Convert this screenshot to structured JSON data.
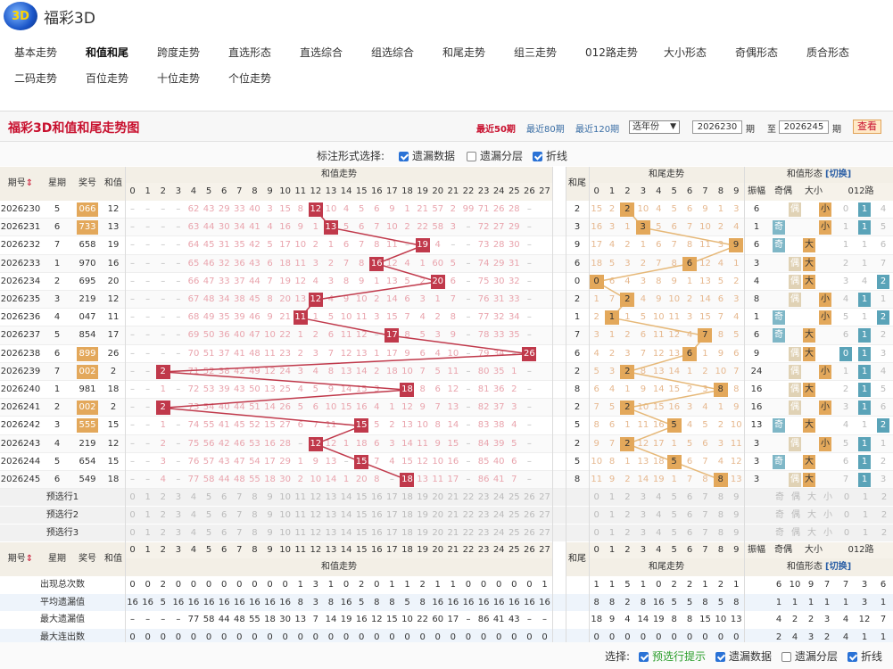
{
  "app": {
    "title": "福彩3D",
    "logo_text": "3D"
  },
  "nav": {
    "row1": [
      "基本走势",
      "和值和尾",
      "跨度走势",
      "直选形态",
      "直选综合",
      "组选综合",
      "和尾走势",
      "组三走势",
      "012路走势",
      "大小形态",
      "奇偶形态",
      "质合形态"
    ],
    "row2": [
      "二码走势",
      "百位走势",
      "十位走势",
      "个位走势"
    ],
    "active": "和值和尾"
  },
  "panel": {
    "title": "福彩3D和值和尾走势图",
    "ranges": [
      "最近50期",
      "最近80期",
      "最近120期"
    ],
    "year_select": "选年份",
    "from_label": "期",
    "to_label": "至",
    "to_label2": "期",
    "from_period": "2026230",
    "to_period": "2026245",
    "query": "查看"
  },
  "marking": {
    "label": "标注形式选择:",
    "options": [
      {
        "label": "遗漏数据",
        "checked": true
      },
      {
        "label": "遗漏分层",
        "checked": false
      },
      {
        "label": "折线",
        "checked": true
      }
    ]
  },
  "columns": {
    "issue": "期号",
    "week": "星期",
    "prize": "奖号",
    "sum": "和值",
    "sum_trend": "和值走势",
    "tail": "和尾",
    "tail_trend": "和尾走势",
    "form": "和值形态",
    "switch": "[切换]",
    "amplitude": "振幅",
    "parity": "奇偶",
    "size": "大小",
    "route": "012路",
    "sort_icon": "⇕"
  },
  "rows": [
    {
      "issue": "2026230",
      "week": "5",
      "prize": "066",
      "sum": 12,
      "tail": 2,
      "hl": true,
      "amp": "6",
      "par": "偶",
      "sz": "小",
      "route": [
        0,
        "",
        4
      ],
      "sum_omit": [
        "",
        "",
        "",
        "",
        "62",
        "43",
        "29",
        "33",
        "40",
        "3",
        "15",
        "8",
        "",
        "10",
        "4",
        "5",
        "6",
        "9",
        "1",
        "21",
        "57",
        "2",
        "99",
        "71",
        "26",
        "28",
        ""
      ],
      "tail_omit": [
        "15",
        "2",
        "",
        "10",
        "4",
        "5",
        "6",
        "9",
        "1",
        "3"
      ]
    },
    {
      "issue": "2026231",
      "week": "6",
      "prize": "733",
      "sum": 13,
      "tail": 3,
      "hl": true,
      "amp": "1",
      "par": "奇",
      "sz": "小",
      "route": [
        1,
        "",
        5
      ],
      "sum_omit": [
        "",
        "",
        "",
        "",
        "63",
        "44",
        "30",
        "34",
        "41",
        "4",
        "16",
        "9",
        "1",
        "",
        "5",
        "6",
        "7",
        "10",
        "2",
        "22",
        "58",
        "3",
        "",
        "72",
        "27",
        "29",
        ""
      ],
      "tail_omit": [
        "16",
        "3",
        "1",
        "",
        "5",
        "6",
        "7",
        "10",
        "2",
        "4"
      ]
    },
    {
      "issue": "2026232",
      "week": "7",
      "prize": "658",
      "sum": 19,
      "tail": 9,
      "hl": false,
      "amp": "6",
      "par": "奇",
      "sz": "大",
      "route": [
        1,
        1,
        6
      ],
      "sum_omit": [
        "",
        "",
        "",
        "",
        "64",
        "45",
        "31",
        "35",
        "42",
        "5",
        "17",
        "10",
        "2",
        "1",
        "6",
        "7",
        "8",
        "11",
        "",
        "59",
        "4",
        "",
        "",
        "73",
        "28",
        "30",
        ""
      ],
      "tail_omit": [
        "17",
        "4",
        "2",
        "1",
        "6",
        "7",
        "8",
        "11",
        "3",
        ""
      ]
    },
    {
      "issue": "2026233",
      "week": "1",
      "prize": "970",
      "sum": 16,
      "tail": 6,
      "hl": false,
      "amp": "3",
      "par": "偶",
      "sz": "大",
      "route": [
        2,
        1,
        7
      ],
      "sum_omit": [
        "",
        "",
        "",
        "",
        "65",
        "46",
        "32",
        "36",
        "43",
        "6",
        "18",
        "11",
        "3",
        "2",
        "7",
        "8",
        "",
        "12",
        "4",
        "1",
        "60",
        "5",
        "",
        "74",
        "29",
        "31",
        ""
      ],
      "tail_omit": [
        "18",
        "5",
        "3",
        "2",
        "7",
        "8",
        "",
        "12",
        "4",
        "1"
      ]
    },
    {
      "issue": "2026234",
      "week": "2",
      "prize": "695",
      "sum": 20,
      "tail": 0,
      "hl": false,
      "amp": "4",
      "par": "偶",
      "sz": "大",
      "route": [
        3,
        4,
        ""
      ],
      "sum_omit": [
        "",
        "",
        "",
        "",
        "66",
        "47",
        "33",
        "37",
        "44",
        "7",
        "19",
        "12",
        "4",
        "3",
        "8",
        "9",
        "1",
        "13",
        "5",
        "2",
        "",
        "6",
        "",
        "75",
        "30",
        "32",
        ""
      ],
      "tail_omit": [
        "",
        "6",
        "4",
        "3",
        "8",
        "9",
        "1",
        "13",
        "5",
        "2"
      ]
    },
    {
      "issue": "2026235",
      "week": "3",
      "prize": "219",
      "sum": 12,
      "tail": 2,
      "hl": false,
      "amp": "8",
      "par": "偶",
      "sz": "小",
      "route": [
        4,
        "",
        1
      ],
      "sum_omit": [
        "",
        "",
        "",
        "",
        "67",
        "48",
        "34",
        "38",
        "45",
        "8",
        "20",
        "13",
        "",
        "4",
        "9",
        "10",
        "2",
        "14",
        "6",
        "3",
        "1",
        "7",
        "",
        "76",
        "31",
        "33",
        ""
      ],
      "tail_omit": [
        "1",
        "7",
        "",
        "4",
        "9",
        "10",
        "2",
        "14",
        "6",
        "3"
      ]
    },
    {
      "issue": "2026236",
      "week": "4",
      "prize": "047",
      "sum": 11,
      "tail": 1,
      "hl": false,
      "amp": "1",
      "par": "奇",
      "sz": "小",
      "route": [
        5,
        1,
        ""
      ],
      "sum_omit": [
        "",
        "",
        "",
        "",
        "68",
        "49",
        "35",
        "39",
        "46",
        "9",
        "21",
        "",
        "1",
        "5",
        "10",
        "11",
        "3",
        "15",
        "7",
        "4",
        "2",
        "8",
        "",
        "77",
        "32",
        "34",
        ""
      ],
      "tail_omit": [
        "2",
        "",
        "1",
        "5",
        "10",
        "11",
        "3",
        "15",
        "7",
        "4"
      ]
    },
    {
      "issue": "2026237",
      "week": "5",
      "prize": "854",
      "sum": 17,
      "tail": 7,
      "hl": false,
      "amp": "6",
      "par": "奇",
      "sz": "大",
      "route": [
        6,
        "",
        2
      ],
      "sum_omit": [
        "",
        "",
        "",
        "",
        "69",
        "50",
        "36",
        "40",
        "47",
        "10",
        "22",
        "1",
        "2",
        "6",
        "11",
        "12",
        "",
        "16",
        "8",
        "5",
        "3",
        "9",
        "",
        "78",
        "33",
        "35",
        ""
      ],
      "tail_omit": [
        "3",
        "1",
        "2",
        "6",
        "11",
        "12",
        "4",
        "",
        "8",
        "5"
      ]
    },
    {
      "issue": "2026238",
      "week": "6",
      "prize": "899",
      "sum": 26,
      "tail": 6,
      "hl": true,
      "amp": "9",
      "par": "偶",
      "sz": "大",
      "route": [
        "",
        "",
        3
      ],
      "sum_omit": [
        "",
        "",
        "",
        "",
        "70",
        "51",
        "37",
        "41",
        "48",
        "11",
        "23",
        "2",
        "3",
        "7",
        "12",
        "13",
        "1",
        "17",
        "9",
        "6",
        "4",
        "10",
        "",
        "79",
        "34",
        "",
        ""
      ],
      "tail_omit": [
        "4",
        "2",
        "3",
        "7",
        "12",
        "13",
        "",
        "1",
        "9",
        "6"
      ]
    },
    {
      "issue": "2026239",
      "week": "7",
      "prize": "002",
      "sum": 2,
      "tail": 2,
      "hl": true,
      "amp": "24",
      "par": "偶",
      "sz": "小",
      "route": [
        1,
        "",
        4
      ],
      "sum_omit": [
        "",
        "",
        "",
        "",
        "71",
        "52",
        "38",
        "42",
        "49",
        "12",
        "24",
        "3",
        "4",
        "8",
        "13",
        "14",
        "2",
        "18",
        "10",
        "7",
        "5",
        "11",
        "",
        "80",
        "35",
        "1",
        ""
      ],
      "tail_omit": [
        "5",
        "3",
        "",
        "8",
        "13",
        "14",
        "1",
        "2",
        "10",
        "7"
      ]
    },
    {
      "issue": "2026240",
      "week": "1",
      "prize": "981",
      "sum": 18,
      "tail": 8,
      "hl": false,
      "amp": "16",
      "par": "偶",
      "sz": "大",
      "route": [
        2,
        "",
        5
      ],
      "sum_omit": [
        "",
        "",
        "1",
        "",
        "72",
        "53",
        "39",
        "43",
        "50",
        "13",
        "25",
        "4",
        "5",
        "9",
        "14",
        "15",
        "3",
        "",
        "11",
        "8",
        "6",
        "12",
        "",
        "81",
        "36",
        "2",
        ""
      ],
      "tail_omit": [
        "6",
        "4",
        "1",
        "9",
        "14",
        "15",
        "2",
        "3",
        "",
        "8"
      ]
    },
    {
      "issue": "2026241",
      "week": "2",
      "prize": "002",
      "sum": 2,
      "tail": 2,
      "hl": true,
      "amp": "16",
      "par": "偶",
      "sz": "小",
      "route": [
        3,
        "",
        6
      ],
      "sum_omit": [
        "",
        "",
        "",
        "",
        "73",
        "54",
        "40",
        "44",
        "51",
        "14",
        "26",
        "5",
        "6",
        "10",
        "15",
        "16",
        "4",
        "1",
        "12",
        "9",
        "7",
        "13",
        "",
        "82",
        "37",
        "3",
        ""
      ],
      "tail_omit": [
        "7",
        "5",
        "",
        "10",
        "15",
        "16",
        "3",
        "4",
        "1",
        "9"
      ]
    },
    {
      "issue": "2026242",
      "week": "3",
      "prize": "555",
      "sum": 15,
      "tail": 5,
      "hl": true,
      "amp": "13",
      "par": "奇",
      "sz": "大",
      "route": [
        4,
        1,
        ""
      ],
      "sum_omit": [
        "",
        "",
        "1",
        "",
        "74",
        "55",
        "41",
        "45",
        "52",
        "15",
        "27",
        "6",
        "7",
        "11",
        "",
        "17",
        "5",
        "2",
        "13",
        "10",
        "8",
        "14",
        "",
        "83",
        "38",
        "4",
        ""
      ],
      "tail_omit": [
        "8",
        "6",
        "1",
        "11",
        "16",
        "",
        "4",
        "5",
        "2",
        "10"
      ]
    },
    {
      "issue": "2026243",
      "week": "4",
      "prize": "219",
      "sum": 12,
      "tail": 2,
      "hl": false,
      "amp": "3",
      "par": "偶",
      "sz": "小",
      "route": [
        5,
        "",
        1
      ],
      "sum_omit": [
        "",
        "",
        "2",
        "",
        "75",
        "56",
        "42",
        "46",
        "53",
        "16",
        "28",
        "",
        "8",
        "12",
        "1",
        "18",
        "6",
        "3",
        "14",
        "11",
        "9",
        "15",
        "",
        "84",
        "39",
        "5",
        ""
      ],
      "tail_omit": [
        "9",
        "7",
        "",
        "12",
        "17",
        "1",
        "5",
        "6",
        "3",
        "11"
      ]
    },
    {
      "issue": "2026244",
      "week": "5",
      "prize": "654",
      "sum": 15,
      "tail": 5,
      "hl": false,
      "amp": "3",
      "par": "奇",
      "sz": "大",
      "route": [
        6,
        "",
        2
      ],
      "sum_omit": [
        "",
        "",
        "3",
        "",
        "76",
        "57",
        "43",
        "47",
        "54",
        "17",
        "29",
        "1",
        "9",
        "13",
        "",
        "19",
        "7",
        "4",
        "15",
        "12",
        "10",
        "16",
        "",
        "85",
        "40",
        "6",
        ""
      ],
      "tail_omit": [
        "10",
        "8",
        "1",
        "13",
        "18",
        "",
        "6",
        "7",
        "4",
        "12"
      ]
    },
    {
      "issue": "2026245",
      "week": "6",
      "prize": "549",
      "sum": 18,
      "tail": 8,
      "hl": false,
      "amp": "3",
      "par": "偶",
      "sz": "大",
      "route": [
        7,
        "",
        3
      ],
      "sum_omit": [
        "",
        "",
        "4",
        "",
        "77",
        "58",
        "44",
        "48",
        "55",
        "18",
        "30",
        "2",
        "10",
        "14",
        "1",
        "20",
        "8",
        "",
        "16",
        "13",
        "11",
        "17",
        "",
        "86",
        "41",
        "7",
        ""
      ],
      "tail_omit": [
        "11",
        "9",
        "2",
        "14",
        "19",
        "1",
        "7",
        "8",
        "",
        "13"
      ]
    }
  ],
  "preselect": [
    "预选行1",
    "预选行2",
    "预选行3"
  ],
  "form_labels": {
    "odd": "奇",
    "even": "偶",
    "big": "大",
    "small": "小",
    "r0": "0",
    "r1": "1",
    "r2": "2"
  },
  "stats": [
    {
      "label": "出现总次数",
      "sum": [
        "0",
        "0",
        "2",
        "0",
        "0",
        "0",
        "0",
        "0",
        "0",
        "0",
        "0",
        "1",
        "3",
        "1",
        "0",
        "2",
        "0",
        "1",
        "1",
        "2",
        "1",
        "1",
        "0",
        "0",
        "0",
        "0",
        "0",
        "1",
        "0"
      ],
      "tail": [
        "1",
        "1",
        "5",
        "1",
        "0",
        "2",
        "2",
        "1",
        "2",
        "1"
      ],
      "form": [
        "",
        "6",
        "10",
        "9",
        "7",
        "7",
        "3",
        "6"
      ]
    },
    {
      "label": "平均遗漏值",
      "sum": [
        "16",
        "16",
        "5",
        "16",
        "16",
        "16",
        "16",
        "16",
        "16",
        "16",
        "16",
        "8",
        "3",
        "8",
        "16",
        "5",
        "8",
        "8",
        "5",
        "8",
        "16",
        "16",
        "16",
        "16",
        "16",
        "16",
        "16",
        "16"
      ],
      "tail": [
        "8",
        "8",
        "2",
        "8",
        "16",
        "5",
        "5",
        "8",
        "5",
        "8"
      ],
      "form": [
        "",
        "1",
        "1",
        "1",
        "1",
        "1",
        "3",
        "1"
      ]
    },
    {
      "label": "最大遗漏值",
      "sum": [
        "",
        "",
        "",
        "",
        "77",
        "58",
        "44",
        "48",
        "55",
        "18",
        "30",
        "13",
        "7",
        "14",
        "19",
        "16",
        "12",
        "15",
        "10",
        "22",
        "60",
        "17",
        "",
        "86",
        "41",
        "43",
        "",
        ""
      ],
      "tail": [
        "18",
        "9",
        "4",
        "14",
        "19",
        "8",
        "8",
        "15",
        "10",
        "13"
      ],
      "form": [
        "",
        "4",
        "2",
        "2",
        "3",
        "4",
        "12",
        "7"
      ]
    },
    {
      "label": "最大连出数",
      "sum": [
        "0",
        "0",
        "0",
        "0",
        "0",
        "0",
        "0",
        "0",
        "0",
        "0",
        "0",
        "0",
        "0",
        "0",
        "0",
        "0",
        "0",
        "0",
        "0",
        "0",
        "0",
        "0",
        "0",
        "0",
        "0",
        "0",
        "0",
        "0"
      ],
      "tail": [
        "0",
        "0",
        "0",
        "0",
        "0",
        "0",
        "0",
        "0",
        "0",
        "0"
      ],
      "form": [
        "",
        "2",
        "4",
        "3",
        "2",
        "4",
        "1",
        "1"
      ]
    }
  ],
  "bottom": {
    "label": "选择:",
    "options": [
      {
        "label": "预选行提示",
        "checked": true,
        "green": true
      },
      {
        "label": "遗漏数据",
        "checked": true
      },
      {
        "label": "遗漏分层",
        "checked": false
      },
      {
        "label": "折线",
        "checked": true
      }
    ]
  }
}
